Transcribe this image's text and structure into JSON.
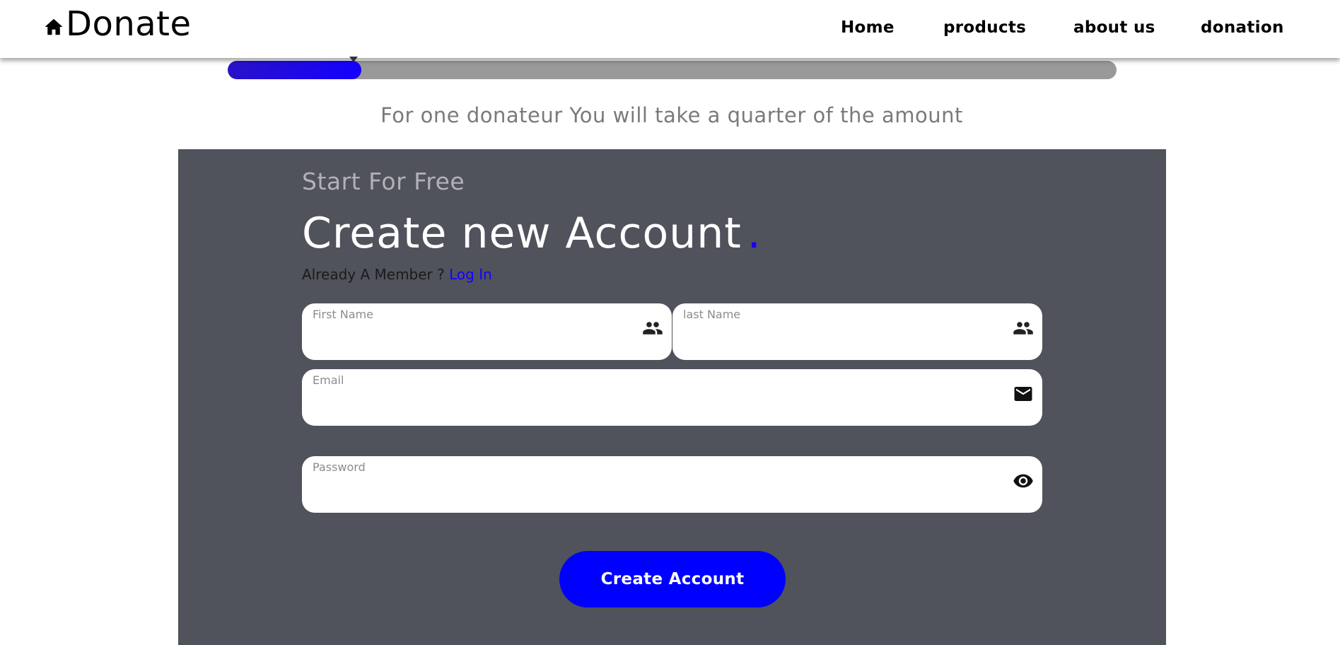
{
  "header": {
    "brand": "Donate",
    "brand_icon": "home-icon",
    "nav": [
      {
        "label": "Home"
      },
      {
        "label": "products"
      },
      {
        "label": "about us"
      },
      {
        "label": "donation"
      }
    ]
  },
  "progress": {
    "fraction": 0.15,
    "color": "#1400ff",
    "track_color": "#999999"
  },
  "subtitle": "For one donateur You will take a quarter of the amount",
  "form": {
    "eyebrow": "Start For Free",
    "title": "Create new Account",
    "title_dot": ".",
    "member_text": "Already A Member ?",
    "login_link": "Log In",
    "fields": {
      "first_name": {
        "label": "First Name",
        "value": "",
        "icon": "people-icon"
      },
      "last_name": {
        "label": "last Name",
        "value": "",
        "icon": "people-icon"
      },
      "email": {
        "label": "Email",
        "value": "",
        "icon": "mail-icon"
      },
      "password": {
        "label": "Password",
        "value": "",
        "icon": "eye-icon"
      }
    },
    "submit_label": "Create Account"
  },
  "colors": {
    "accent": "#0000ff",
    "panel": "#50525c"
  }
}
